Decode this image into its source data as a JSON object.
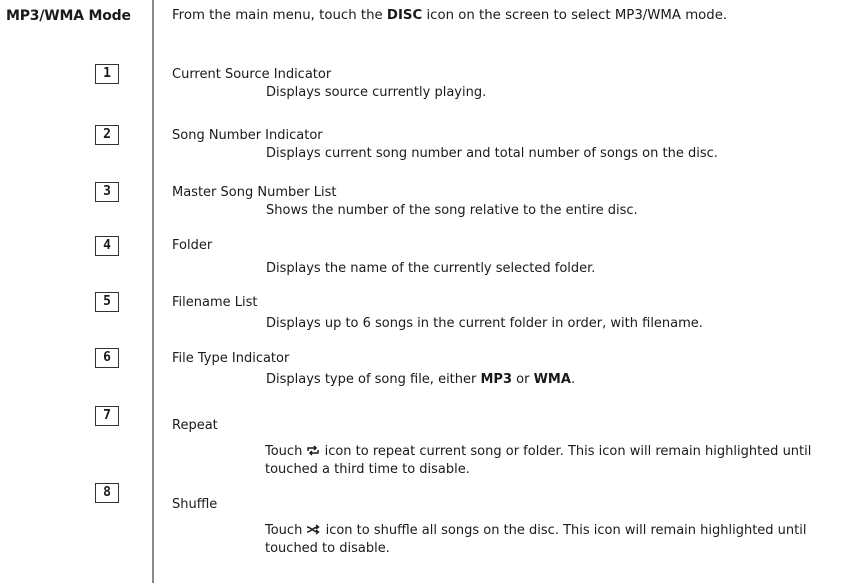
{
  "section": {
    "title": "MP3/WMA Mode",
    "intro_pre": "From the main menu, touch the ",
    "intro_bold": "DISC",
    "intro_post": " icon on the screen to select MP3/WMA mode."
  },
  "items": [
    {
      "number": "1",
      "title": "Current Source Indicator",
      "description": "Displays source currently playing."
    },
    {
      "number": "2",
      "title": "Song Number Indicator",
      "description": "Displays current song number and total number of songs on the disc."
    },
    {
      "number": "3",
      "title": "Master Song Number List",
      "description": "Shows the number of the song relative to the entire disc."
    },
    {
      "number": "4",
      "title": "Folder",
      "description": "Displays the name of the currently selected folder."
    },
    {
      "number": "5",
      "title": "Filename List",
      "description": "Displays up to 6 songs in the current folder in order, with filename."
    },
    {
      "number": "6",
      "title": "File Type Indicator",
      "description_pre": "Displays type of song file, either ",
      "description_bold1": "MP3",
      "description_mid": " or ",
      "description_bold2": "WMA",
      "description_post": "."
    },
    {
      "number": "7",
      "title": "Repeat",
      "description_pre": "Touch ",
      "icon": "repeat-icon",
      "description_post": " icon to repeat current song or folder. This icon will remain highlighted until touched a third time to disable."
    },
    {
      "number": "8",
      "title": "Shuffle",
      "description_pre": "Touch ",
      "icon": "shuffle-icon",
      "description_post": " icon to shuffle all songs on the disc. This icon will remain highlighted until touched to disable."
    }
  ]
}
